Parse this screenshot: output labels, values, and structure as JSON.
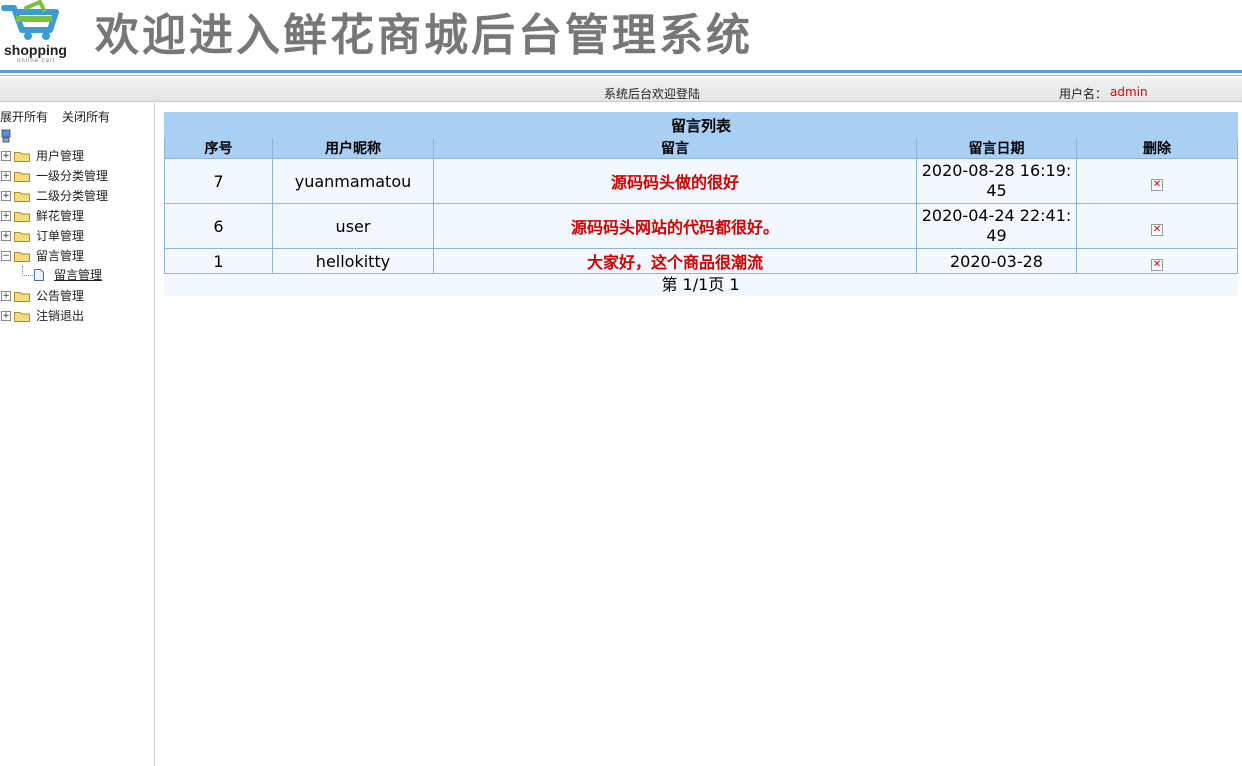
{
  "header": {
    "logo_text": "shopping",
    "logo_subtext": "online cart",
    "title": "欢迎进入鲜花商城后台管理系统"
  },
  "statusbar": {
    "welcome": "系统后台欢迎登陆",
    "user_label": "用户名：",
    "user_name": "admin"
  },
  "sidebar": {
    "expand_all": "展开所有",
    "collapse_all": "关闭所有",
    "items": [
      {
        "label": "用户管理"
      },
      {
        "label": "一级分类管理"
      },
      {
        "label": "二级分类管理"
      },
      {
        "label": "鲜花管理"
      },
      {
        "label": "订单管理"
      },
      {
        "label": "留言管理"
      },
      {
        "label": "公告管理"
      },
      {
        "label": "注销退出"
      }
    ],
    "active_child": "留言管理"
  },
  "table": {
    "caption": "留言列表",
    "columns": [
      "序号",
      "用户昵称",
      "留言",
      "留言日期",
      "删除"
    ],
    "rows": [
      {
        "id": "7",
        "nickname": "yuanmamatou",
        "message": "源码码头做的很好",
        "date": "2020-08-28 16:19:45"
      },
      {
        "id": "6",
        "nickname": "user",
        "message": "源码码头网站的代码都很好。",
        "date": "2020-04-24 22:41:49"
      },
      {
        "id": "1",
        "nickname": "hellokitty",
        "message": "大家好，这个商品很潮流",
        "date": "2020-03-28"
      }
    ],
    "pager": "第 1/1页 1"
  },
  "colors": {
    "accent": "#5b9bd5",
    "table_header": "#a9cff3",
    "message_text": "#d40000",
    "user_name": "#e00000"
  }
}
